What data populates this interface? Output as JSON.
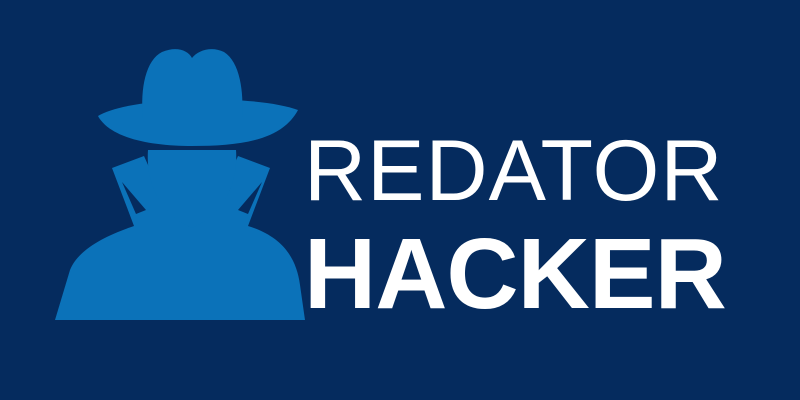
{
  "colors": {
    "background": "#052b5e",
    "figure": "#0b72b9",
    "text": "#ffffff"
  },
  "logo": {
    "icon": "hacker-spy-icon",
    "wordmark": {
      "line1": "REDATOR",
      "line2": "HACKER"
    }
  }
}
